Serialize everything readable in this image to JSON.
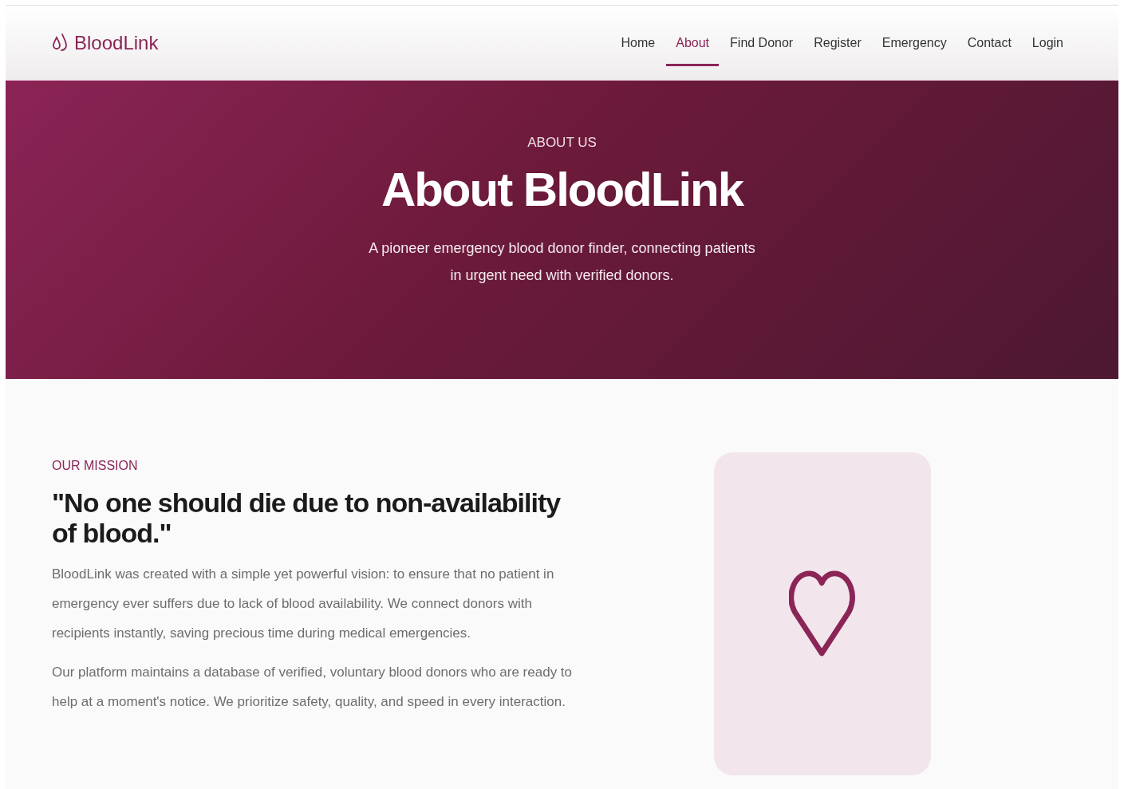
{
  "brand": {
    "name": "BloodLink"
  },
  "nav": [
    {
      "label": "Home",
      "selected": false
    },
    {
      "label": "About",
      "selected": true
    },
    {
      "label": "Find Donor",
      "selected": false
    },
    {
      "label": "Register",
      "selected": false
    },
    {
      "label": "Emergency",
      "selected": false
    },
    {
      "label": "Contact",
      "selected": false
    },
    {
      "label": "Login",
      "selected": false
    }
  ],
  "hero": {
    "eyebrow": "ABOUT US",
    "title": "About BloodLink",
    "subtitle": "A pioneer emergency blood donor finder, connecting patients in urgent need with verified donors."
  },
  "mission": {
    "eyebrow": "OUR MISSION",
    "quote": "\"No one should die due to non-availability of blood.\"",
    "paragraphs": [
      "BloodLink was created with a simple yet powerful vision: to ensure that no patient in emergency ever suffers due to lack of blood availability. We connect donors with recipients instantly, saving precious time during medical emergencies.",
      "Our platform maintains a database of verified, voluntary blood donors who are ready to help at a moment's notice. We prioritize safety, quality, and speed in every interaction."
    ]
  }
}
